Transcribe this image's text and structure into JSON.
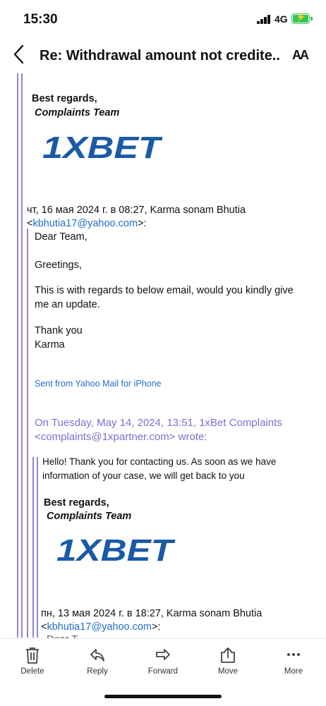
{
  "status": {
    "time": "15:30",
    "network": "4G"
  },
  "nav": {
    "subject": "Re: Withdrawal amount not credite...",
    "text_size_label": "AA"
  },
  "email": {
    "top_regards": "Best regards,",
    "top_team": "Complaints Team",
    "logo_text": "1XBET",
    "quote1_header_line1": "чт, 16 мая 2024 г. в 08:27, Karma sonam Bhutia",
    "quote1_header_open": "<",
    "quote1_email": "kbhutia17@yahoo.com",
    "quote1_header_close": ">:",
    "body_dear": "Dear Team,",
    "body_greetings": "Greetings,",
    "body_line1": "This is with regards to below email, would you kindly give",
    "body_line2": "me an update.",
    "body_thanks": "Thank you",
    "body_name": "Karma",
    "sent_from": "Sent from Yahoo Mail for iPhone",
    "quote2_header_line1": "On Tuesday, May 14, 2024, 13:51, 1xBet Complaints",
    "quote2_header_open": "<",
    "quote2_email": "complaints@1xpartner.com",
    "quote2_header_close": "> wrote:",
    "reply_line1": "Hello! Thank you for contacting us.  As soon as we have",
    "reply_line2": "information of your case, we will get back to you",
    "inner_regards": "Best regards,",
    "inner_team": "Complaints Team",
    "quote3_header_line1": "пн, 13 мая 2024 г. в 18:27, Karma sonam Bhutia",
    "quote3_header_open": "<",
    "quote3_email": "kbhutia17@yahoo.com",
    "quote3_header_close": ">:",
    "cut_text": "Dear T..."
  },
  "toolbar": {
    "delete": "Delete",
    "reply": "Reply",
    "forward": "Forward",
    "move": "Move",
    "more": "More"
  },
  "colors": {
    "link": "#1f6fcf",
    "quote_bar": "#8b86d9",
    "logo_blue": "#1a5aa6",
    "battery": "#34c759"
  }
}
